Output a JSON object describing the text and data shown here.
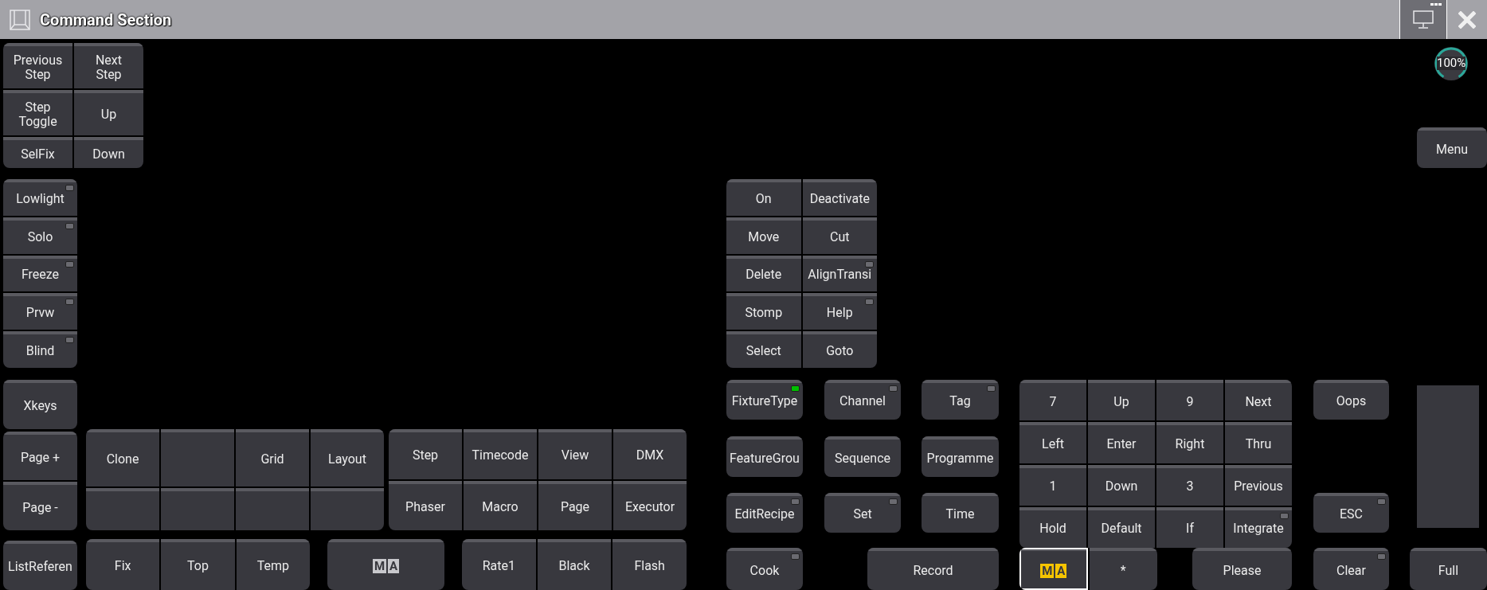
{
  "window": {
    "title": "Command Section"
  },
  "zoom_dial": {
    "reading": "100%"
  },
  "groups": [
    {
      "keys": [
        {
          "label": "Previous\nStep"
        },
        {
          "label": "Next\nStep"
        },
        {
          "label": "Step\nToggle"
        },
        {
          "label": "Up"
        },
        {
          "label": "SelFix"
        },
        {
          "label": "Down"
        }
      ]
    },
    {
      "keys": [
        {
          "label": "Menu"
        }
      ]
    },
    {
      "keys": [
        {
          "label": "Lowlight",
          "lit": false
        },
        {
          "label": "Solo",
          "lit": false
        },
        {
          "label": "Freeze",
          "lit": false
        },
        {
          "label": "Prvw",
          "lit": false
        },
        {
          "label": "Blind",
          "lit": false
        }
      ]
    },
    {
      "keys": [
        {
          "label": "On"
        },
        {
          "label": "Deactivate"
        },
        {
          "label": "Move"
        },
        {
          "label": "Cut"
        },
        {
          "label": "Delete"
        },
        {
          "label": "AlignTransi",
          "lit": false
        },
        {
          "label": "Stomp"
        },
        {
          "label": "Help",
          "lit": false
        },
        {
          "label": "Select"
        },
        {
          "label": "Goto"
        }
      ]
    },
    {
      "keys": [
        {
          "label": "Xkeys"
        }
      ]
    },
    {
      "keys": [
        {
          "label": "Page +"
        },
        {
          "label": "Page -"
        }
      ]
    },
    {
      "keys": [
        {
          "label": "ListReferen"
        }
      ]
    },
    {
      "keys": [
        {
          "label": "Clone"
        },
        {
          "label": "Grid"
        },
        {
          "label": "Layout"
        }
      ]
    },
    {
      "keys": [
        {
          "label": "Step"
        },
        {
          "label": "Timecode"
        },
        {
          "label": "View"
        },
        {
          "label": "DMX"
        },
        {
          "label": "Phaser"
        },
        {
          "label": "Macro"
        },
        {
          "label": "Page"
        },
        {
          "label": "Executor"
        }
      ]
    },
    {
      "keys": [
        {
          "label": "Fix"
        },
        {
          "label": "Top"
        },
        {
          "label": "Temp"
        }
      ]
    },
    {
      "keys": [
        {
          "logo": [
            "M",
            "A"
          ],
          "highlighted": false
        }
      ]
    },
    {
      "keys": [
        {
          "label": "Rate1"
        },
        {
          "label": "Black"
        },
        {
          "label": "Flash"
        }
      ]
    },
    {
      "keys": [
        {
          "label": "FixtureType",
          "lit": true
        }
      ]
    },
    {
      "keys": [
        {
          "label": "Channel",
          "lit": false
        }
      ]
    },
    {
      "keys": [
        {
          "label": "Tag",
          "lit": false
        }
      ]
    },
    {
      "keys": [
        {
          "label": "FeatureGrou"
        }
      ]
    },
    {
      "keys": [
        {
          "label": "Sequence"
        }
      ]
    },
    {
      "keys": [
        {
          "label": "Programme"
        }
      ]
    },
    {
      "keys": [
        {
          "label": "EditRecipe",
          "lit": false
        }
      ]
    },
    {
      "keys": [
        {
          "label": "Set",
          "lit": false
        }
      ]
    },
    {
      "keys": [
        {
          "label": "Time"
        }
      ]
    },
    {
      "keys": [
        {
          "label": "Cook",
          "lit": false
        }
      ]
    },
    {
      "keys": [
        {
          "label": "Record"
        }
      ]
    },
    {
      "keys": [
        {
          "label": "7"
        },
        {
          "label": "Up"
        },
        {
          "label": "9"
        },
        {
          "label": "Next"
        },
        {
          "label": "Left"
        },
        {
          "label": "Enter"
        },
        {
          "label": "Right"
        },
        {
          "label": "Thru"
        },
        {
          "label": "1"
        },
        {
          "label": "Down"
        },
        {
          "label": "3"
        },
        {
          "label": "Previous"
        },
        {
          "label": "Hold"
        },
        {
          "label": "Default"
        },
        {
          "label": "If"
        },
        {
          "label": "Integrate",
          "lit": false
        }
      ]
    },
    {
      "keys": [
        {
          "logo": [
            "M",
            "A"
          ],
          "highlighted": true
        },
        {
          "label": "*"
        }
      ]
    },
    {
      "keys": [
        {
          "label": "Please"
        }
      ]
    },
    {
      "keys": [
        {
          "label": "Oops"
        }
      ]
    },
    {
      "keys": [
        {
          "label": "ESC",
          "lit": false
        }
      ]
    },
    {
      "keys": [
        {
          "label": "Clear",
          "lit": false
        }
      ]
    },
    {
      "keys": [
        {
          "label": "Full"
        }
      ]
    }
  ]
}
